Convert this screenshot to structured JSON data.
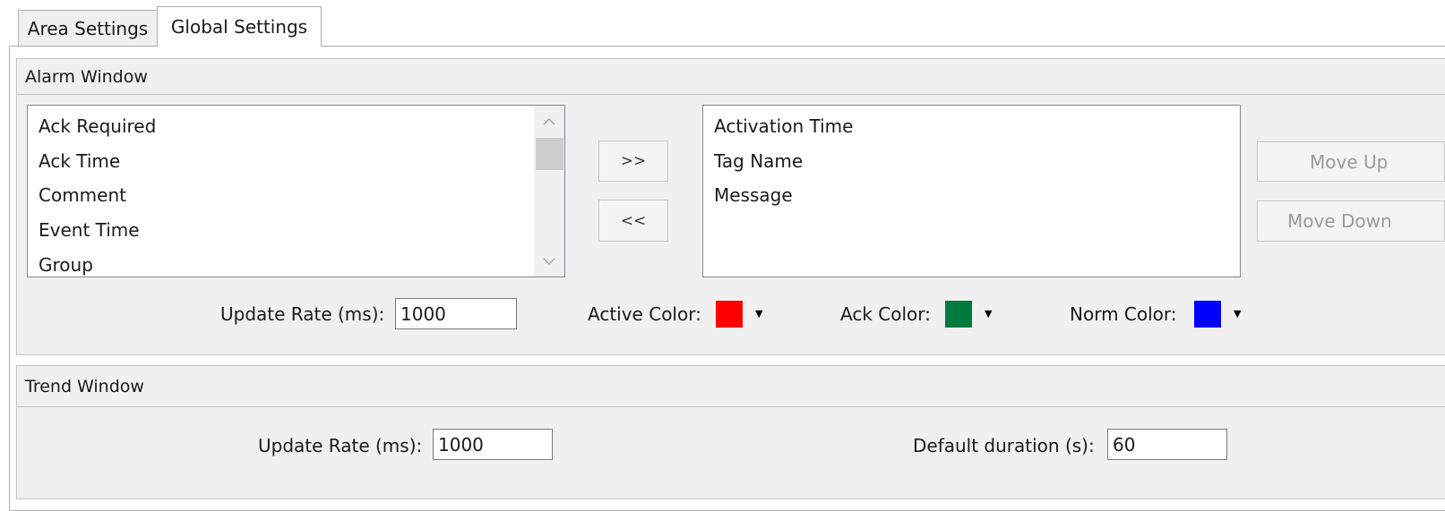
{
  "tabs": [
    {
      "label": "Area Settings",
      "active": false
    },
    {
      "label": "Global Settings",
      "active": true
    }
  ],
  "alarm_window": {
    "title": "Alarm Window",
    "available_columns": [
      "Ack Required",
      "Ack Time",
      "Comment",
      "Event Time",
      "Group"
    ],
    "selected_columns": [
      "Activation Time",
      "Tag Name",
      "Message"
    ],
    "add_button": ">>",
    "remove_button": "<<",
    "move_up_button": "Move Up",
    "move_down_button": "Move Down",
    "update_rate_label": "Update Rate (ms):",
    "update_rate_value": "1000",
    "active_color_label": "Active Color:",
    "active_color": "#ff0000",
    "ack_color_label": "Ack Color:",
    "ack_color": "#007a3d",
    "norm_color_label": "Norm Color:",
    "norm_color": "#0000ff"
  },
  "trend_window": {
    "title": "Trend Window",
    "update_rate_label": "Update Rate (ms):",
    "update_rate_value": "1000",
    "default_duration_label": "Default duration (s):",
    "default_duration_value": "60"
  },
  "icons": {
    "scroll_up": "chevron-up-icon",
    "scroll_down": "chevron-down-icon",
    "dropdown": "caret-down-icon"
  }
}
